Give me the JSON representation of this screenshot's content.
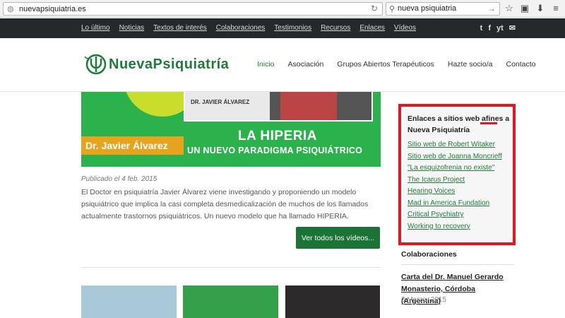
{
  "browser": {
    "url": "nuevapsiquiatria.es",
    "search_value": "nueva psiquiatria",
    "icons": [
      "globe-icon",
      "reload-icon",
      "search-icon",
      "star-icon",
      "bookmarks-icon",
      "download-icon",
      "menu-icon"
    ]
  },
  "topnav": {
    "links": [
      "Lo último",
      "Noticias",
      "Textos de interés",
      "Colaboraciones",
      "Testimonios",
      "Recursos",
      "Enlaces",
      "Vídeos"
    ],
    "social": [
      "t",
      "f",
      "yt",
      "✉"
    ]
  },
  "header": {
    "logo_text": "NuevaPsiquiatría",
    "nav": [
      "Inicio",
      "Asociación",
      "Grupos Abiertos Terapéuticos",
      "Hazte socio/a",
      "Contacto"
    ]
  },
  "hero": {
    "nameplate": "DR. JAVIER ÁLVAREZ",
    "title_line1": "LA HIPERIA",
    "title_line2": "UN NUEVO PARADIGMA PSIQUIÁTRICO",
    "name": "Dr. Javier Álvarez"
  },
  "post": {
    "published": "Publicado el 4 feb. 2015",
    "excerpt": "El Doctor en psiquiatría Javier Álvarez viene investigando y proponiendo un modelo psiquiátrico que implica la casi completa desmedicalización de muchos de los llamados actualmente trastornos psiquiátricos. Un nuevo modelo que ha llamado HIPERIA.",
    "button": "Ver todos los vídeos..."
  },
  "sidebar": {
    "box_title": "Enlaces a sitios web afines a Nueva Psiquiatría",
    "links": [
      "Sitio web de Robert Witaker",
      "Sitio web de Joanna Moncrieff",
      "\"La esquizofrenia no existe\"",
      "The Icarus Project",
      "Hearing Voices",
      "Mad in America Fundation",
      "Critical Psychiatry",
      "Working to recovery"
    ],
    "colab_heading": "Colaboraciones",
    "colab_title": "Carta del Dr. Manuel Gerardo Monasterio, Córdoba (Argentina)",
    "colab_date": "3 Marzo. 2015"
  },
  "colors": {
    "brand_green": "#1f7a3b",
    "hero_green": "#2bb24c",
    "highlight_red": "#e8141f",
    "topnav_bg": "#26292c"
  }
}
